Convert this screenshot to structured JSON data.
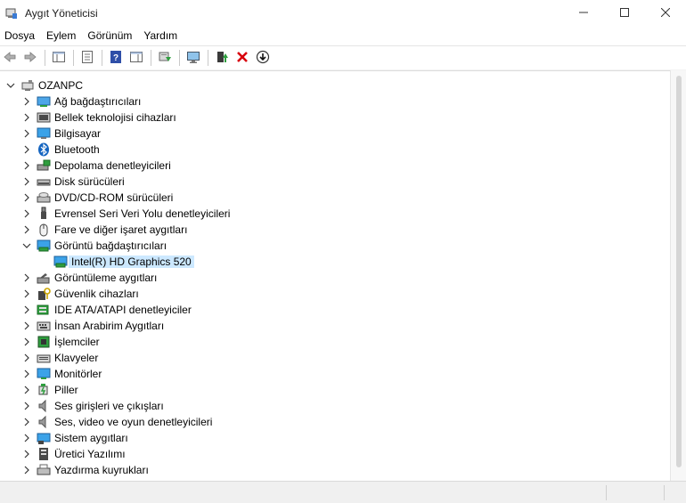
{
  "window": {
    "title": "Aygıt Yöneticisi",
    "controls": [
      "minimize",
      "maximize",
      "close"
    ]
  },
  "menu": [
    "Dosya",
    "Eylem",
    "Görünüm",
    "Yardım"
  ],
  "toolbar": {
    "buttons": [
      "back-arrow-icon",
      "forward-arrow-icon",
      "show-hide-console-tree-icon",
      "properties-icon",
      "help-icon",
      "action-pane-icon",
      "update-driver-icon",
      "scan-hardware-icon",
      "enable-device-icon",
      "uninstall-device-icon",
      "download-icon"
    ]
  },
  "tree": {
    "root": "OZANPC",
    "categories": [
      {
        "label": "Ağ bağdaştırıcıları",
        "icon": "network-adapter-icon",
        "expanded": false
      },
      {
        "label": "Bellek teknolojisi cihazları",
        "icon": "memory-tech-icon",
        "expanded": false
      },
      {
        "label": "Bilgisayar",
        "icon": "computer-icon",
        "expanded": false
      },
      {
        "label": "Bluetooth",
        "icon": "bluetooth-icon",
        "expanded": false
      },
      {
        "label": "Depolama denetleyicileri",
        "icon": "storage-controller-icon",
        "expanded": false
      },
      {
        "label": "Disk sürücüleri",
        "icon": "disk-drive-icon",
        "expanded": false
      },
      {
        "label": "DVD/CD-ROM sürücüleri",
        "icon": "dvd-drive-icon",
        "expanded": false
      },
      {
        "label": "Evrensel Seri Veri Yolu denetleyicileri",
        "icon": "usb-icon",
        "expanded": false
      },
      {
        "label": "Fare ve diğer işaret aygıtları",
        "icon": "mouse-icon",
        "expanded": false
      },
      {
        "label": "Görüntü bağdaştırıcıları",
        "icon": "display-adapter-icon",
        "expanded": true,
        "children": [
          {
            "label": "Intel(R) HD Graphics 520",
            "icon": "display-adapter-icon",
            "selected": true
          }
        ]
      },
      {
        "label": "Görüntüleme aygıtları",
        "icon": "imaging-device-icon",
        "expanded": false
      },
      {
        "label": "Güvenlik cihazları",
        "icon": "security-device-icon",
        "expanded": false
      },
      {
        "label": "IDE ATA/ATAPI denetleyiciler",
        "icon": "ide-controller-icon",
        "expanded": false
      },
      {
        "label": "İnsan Arabirim Aygıtları",
        "icon": "hid-icon",
        "expanded": false
      },
      {
        "label": "İşlemciler",
        "icon": "processor-icon",
        "expanded": false
      },
      {
        "label": "Klavyeler",
        "icon": "keyboard-icon",
        "expanded": false
      },
      {
        "label": "Monitörler",
        "icon": "monitor-icon",
        "expanded": false
      },
      {
        "label": "Piller",
        "icon": "battery-icon",
        "expanded": false
      },
      {
        "label": "Ses girişleri ve çıkışları",
        "icon": "audio-io-icon",
        "expanded": false
      },
      {
        "label": "Ses, video ve oyun denetleyicileri",
        "icon": "sound-video-icon",
        "expanded": false
      },
      {
        "label": "Sistem aygıtları",
        "icon": "system-device-icon",
        "expanded": false
      },
      {
        "label": "Üretici Yazılımı",
        "icon": "firmware-icon",
        "expanded": false
      },
      {
        "label": "Yazdırma kuyrukları",
        "icon": "print-queue-icon",
        "expanded": false
      }
    ]
  },
  "colors": {
    "selection": "#cce8ff",
    "uninstall": "#d8000c",
    "bluetooth": "#1565c0"
  }
}
